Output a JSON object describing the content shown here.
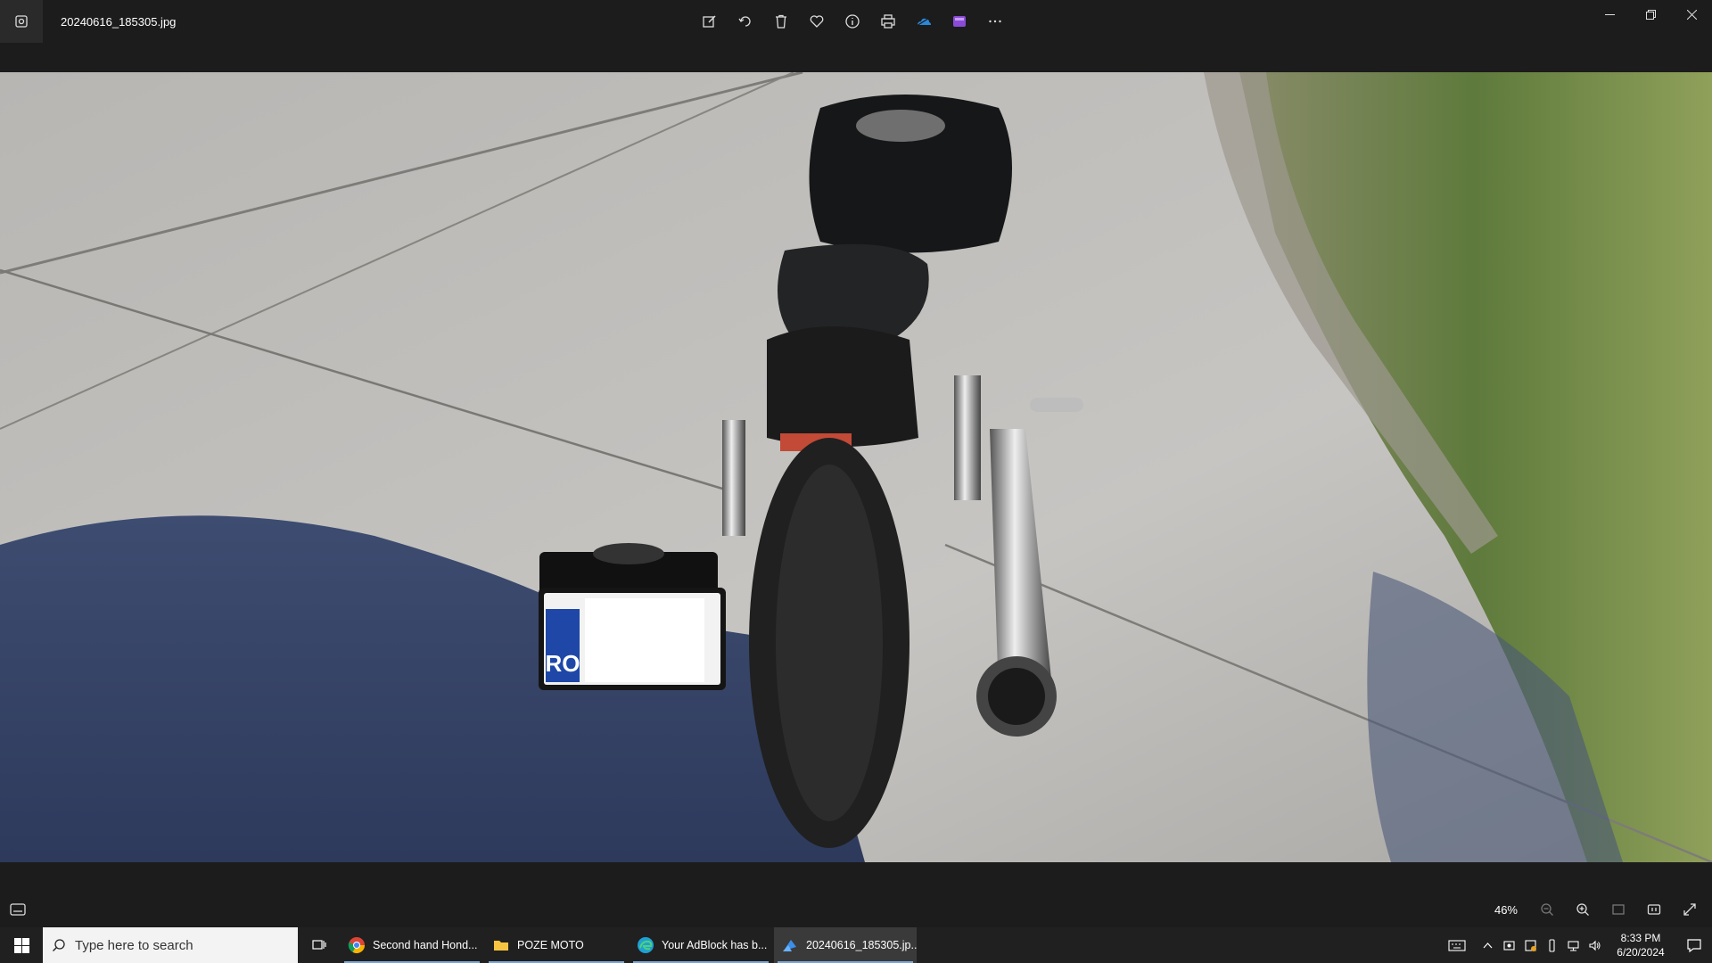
{
  "window": {
    "filename": "20240616_185305.jpg",
    "toolbar_icons": [
      "edit-image-icon",
      "rotate-icon",
      "delete-icon",
      "favorite-icon",
      "info-icon",
      "print-icon",
      "onedrive-icon",
      "clipchamp-icon",
      "more-icon"
    ]
  },
  "photo": {
    "plate_country": "RO"
  },
  "bottombar": {
    "zoom_label": "46%"
  },
  "taskbar": {
    "search_placeholder": "Type here to search",
    "tasks": [
      {
        "label": "Second hand Hond...",
        "icon": "chrome-icon"
      },
      {
        "label": "POZE MOTO",
        "icon": "folder-icon"
      },
      {
        "label": "Your AdBlock has b...",
        "icon": "edge-icon"
      },
      {
        "label": "20240616_185305.jp...",
        "icon": "photos-icon"
      }
    ],
    "clock_time": "8:33 PM",
    "clock_date": "6/20/2024"
  },
  "colors": {
    "titlebar_bg": "#1c1c1c",
    "taskbar_bg": "#202020",
    "active_task_bg": "#3a3a3a",
    "accent": "#7aa7d8"
  }
}
